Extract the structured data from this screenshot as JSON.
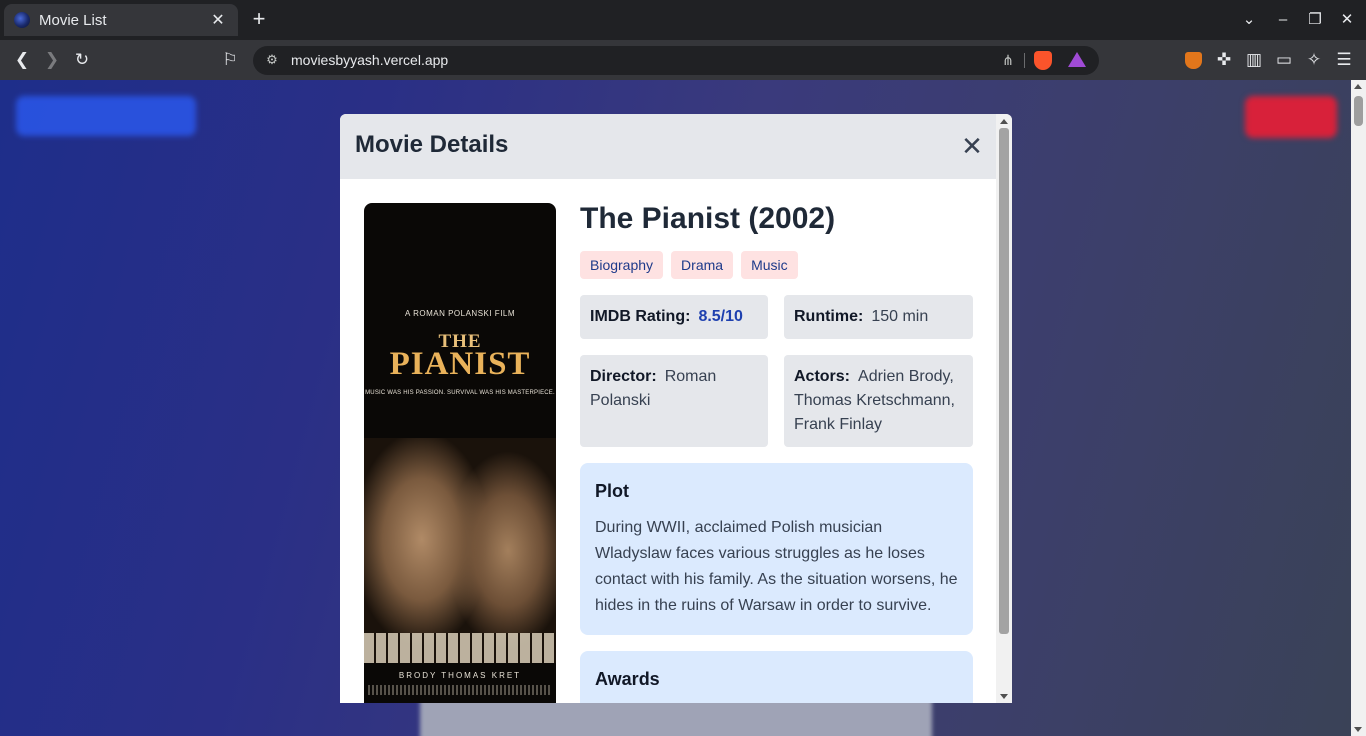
{
  "browser": {
    "tab_title": "Movie List",
    "tab_close": "✕",
    "new_tab": "+",
    "url": "moviesbyyash.vercel.app"
  },
  "modal": {
    "title": "Movie Details",
    "close_label": "✕"
  },
  "poster": {
    "credit_top": "A ROMAN POLANSKI FILM",
    "title_line1": "THE",
    "title_line2": "PIANIST",
    "tagline": "MUSIC WAS HIS PASSION. SURVIVAL WAS HIS MASTERPIECE.",
    "bottom_credit": "BRODY    THOMAS KRET"
  },
  "movie": {
    "title": "The Pianist (2002)",
    "genres": [
      "Biography",
      "Drama",
      "Music"
    ],
    "imdb_label": "IMDB Rating:",
    "imdb_value": "8.5/10",
    "runtime_label": "Runtime:",
    "runtime_value": "150 min",
    "director_label": "Director:",
    "director_value": "Roman Polanski",
    "actors_label": "Actors:",
    "actors_value": "Adrien Brody, Thomas Kretschmann, Frank Finlay",
    "plot_heading": "Plot",
    "plot_text": "During WWII, acclaimed Polish musician Wladyslaw faces various struggles as he loses contact with his family. As the situation worsens, he hides in the ruins of Warsaw in order to survive.",
    "awards_heading": "Awards"
  },
  "colors": {
    "genre_bg": "#fee2e2",
    "genre_text": "#1e3a8a",
    "rating_text": "#1e40af",
    "section_bg": "#dbeafe",
    "info_bg": "#e5e7eb"
  }
}
